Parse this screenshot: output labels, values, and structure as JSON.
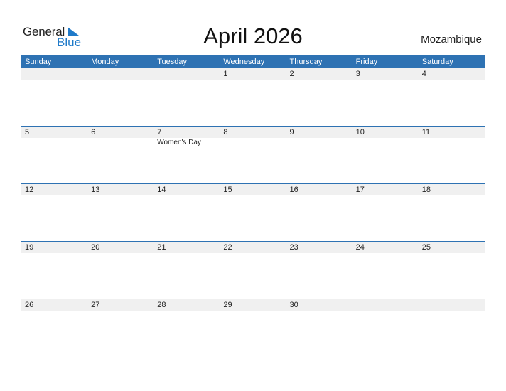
{
  "logo": {
    "line1": "General",
    "line2": "Blue"
  },
  "title": "April 2026",
  "country": "Mozambique",
  "colors": {
    "accent": "#2e72b3",
    "row_bg": "#f0f0f0",
    "logo_blue": "#1f7ac9"
  },
  "weekdays": [
    "Sunday",
    "Monday",
    "Tuesday",
    "Wednesday",
    "Thursday",
    "Friday",
    "Saturday"
  ],
  "weeks": [
    {
      "days": [
        "",
        "",
        "",
        "1",
        "2",
        "3",
        "4"
      ],
      "events": [
        "",
        "",
        "",
        "",
        "",
        "",
        ""
      ]
    },
    {
      "days": [
        "5",
        "6",
        "7",
        "8",
        "9",
        "10",
        "11"
      ],
      "events": [
        "",
        "",
        "Women's Day",
        "",
        "",
        "",
        ""
      ]
    },
    {
      "days": [
        "12",
        "13",
        "14",
        "15",
        "16",
        "17",
        "18"
      ],
      "events": [
        "",
        "",
        "",
        "",
        "",
        "",
        ""
      ]
    },
    {
      "days": [
        "19",
        "20",
        "21",
        "22",
        "23",
        "24",
        "25"
      ],
      "events": [
        "",
        "",
        "",
        "",
        "",
        "",
        ""
      ]
    },
    {
      "days": [
        "26",
        "27",
        "28",
        "29",
        "30",
        "",
        ""
      ],
      "events": [
        "",
        "",
        "",
        "",
        "",
        "",
        ""
      ]
    }
  ]
}
